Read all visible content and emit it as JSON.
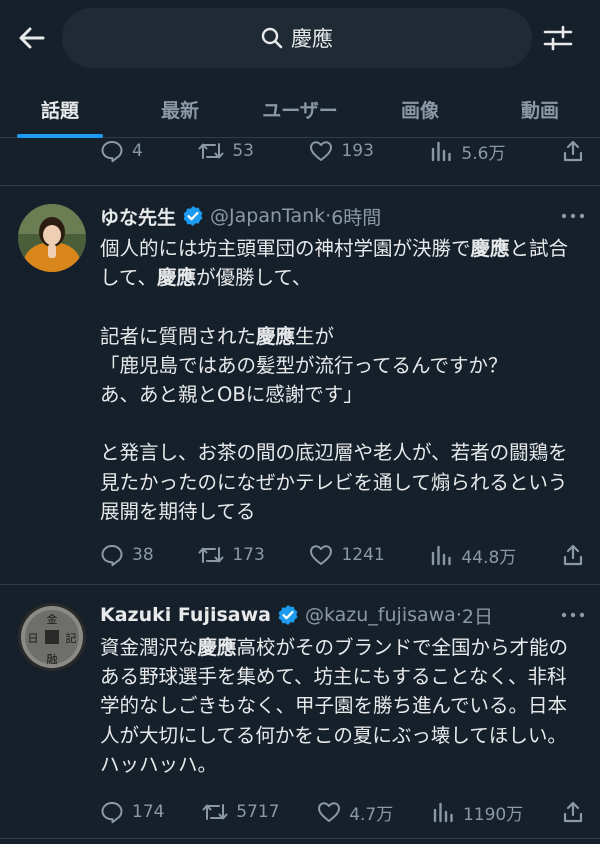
{
  "search": {
    "query": "慶應"
  },
  "tabs": [
    {
      "label": "話題",
      "active": true
    },
    {
      "label": "最新",
      "active": false
    },
    {
      "label": "ユーザー",
      "active": false
    },
    {
      "label": "画像",
      "active": false
    },
    {
      "label": "動画",
      "active": false
    }
  ],
  "prev_tweet_stats": {
    "replies": "4",
    "retweets": "53",
    "likes": "193",
    "views": "5.6万"
  },
  "tweets": [
    {
      "display_name": "ゆな先生",
      "handle": "@JapanTank",
      "time": "6時間",
      "text_parts": [
        [
          "個人的には坊主頭軍団の神村学園が決勝で",
          false
        ],
        [
          "慶應",
          true
        ],
        [
          "と試合して、",
          false
        ],
        [
          "慶應",
          true
        ],
        [
          "が優勝して、\n\n記者に質問された",
          false
        ],
        [
          "慶應",
          true
        ],
        [
          "生が\n「鹿児島ではあの髪型が流行ってるんですか？\nあ、あと親とOBに感謝です」\n\nと発言し、お茶の間の底辺層や老人が、若者の闘鶏を見たかったのになぜかテレビを通して煽られるという展開を期待してる",
          false
        ]
      ],
      "replies": "38",
      "retweets": "173",
      "likes": "1241",
      "views": "44.8万"
    },
    {
      "display_name": "Kazuki Fujisawa",
      "handle": "@kazu_fujisawa",
      "time": "2日",
      "text_parts": [
        [
          "資金潤沢な",
          false
        ],
        [
          "慶應",
          true
        ],
        [
          "高校がそのブランドで全国から才能のある野球選手を集めて、坊主にもすることなく、非科学的なしごきもなく、甲子園を勝ち進んでいる。日本人が大切にしてる何かをこの夏にぶっ壊してほしい。ハッハッハ。",
          false
        ]
      ],
      "replies": "174",
      "retweets": "5717",
      "likes": "4.7万",
      "views": "1190万"
    }
  ],
  "colors": {
    "background": "#15202b",
    "accent": "#1d9bf0",
    "muted": "#8b98a5",
    "text": "#e7e9ea",
    "divider": "#2f3b47"
  },
  "icons": [
    "back-arrow-icon",
    "search-icon",
    "filter-icon",
    "verified-badge-icon",
    "more-icon",
    "reply-icon",
    "retweet-icon",
    "like-icon",
    "views-icon",
    "share-icon"
  ]
}
